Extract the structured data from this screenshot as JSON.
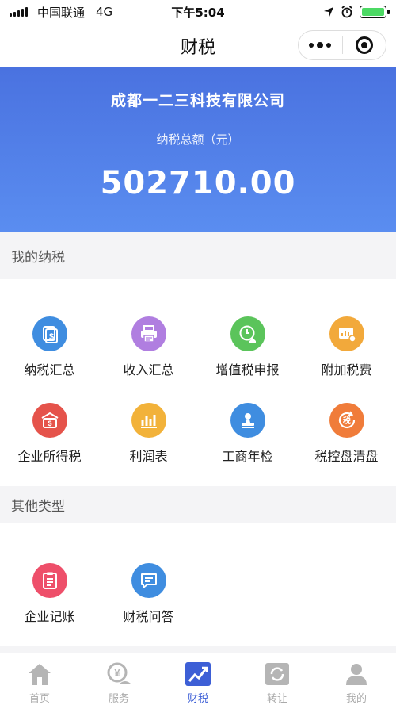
{
  "status_bar": {
    "carrier": "中国联通",
    "network": "4G",
    "time": "下午5:04"
  },
  "nav": {
    "title": "财税"
  },
  "hero": {
    "company": "成都一二三科技有限公司",
    "amount_label": "纳税总额（元）",
    "amount": "502710.00"
  },
  "sections": {
    "mine": {
      "title": "我的纳税",
      "items": [
        {
          "label": "纳税汇总",
          "icon": "dollar-doc-icon",
          "color": "#3f8de0"
        },
        {
          "label": "收入汇总",
          "icon": "printer-icon",
          "color": "#b07ee0"
        },
        {
          "label": "增值税申报",
          "icon": "clock-home-icon",
          "color": "#5bc45b"
        },
        {
          "label": "附加税费",
          "icon": "chart-card-icon",
          "color": "#f2a93b"
        },
        {
          "label": "企业所得税",
          "icon": "money-box-icon",
          "color": "#e5534b"
        },
        {
          "label": "利润表",
          "icon": "bar-chart-icon",
          "color": "#f2b23a"
        },
        {
          "label": "工商年检",
          "icon": "stamp-icon",
          "color": "#3f8de0"
        },
        {
          "label": "税控盘清盘",
          "icon": "tax-refresh-icon",
          "color": "#f07c3a"
        }
      ]
    },
    "other": {
      "title": "其他类型",
      "items": [
        {
          "label": "企业记账",
          "icon": "ledger-icon",
          "color": "#ee4f6a"
        },
        {
          "label": "财税问答",
          "icon": "chat-icon",
          "color": "#3f8de0"
        }
      ]
    }
  },
  "tabbar": {
    "items": [
      {
        "label": "首页",
        "icon": "home-icon"
      },
      {
        "label": "服务",
        "icon": "service-icon"
      },
      {
        "label": "财税",
        "icon": "trend-icon",
        "active": true
      },
      {
        "label": "转让",
        "icon": "transfer-icon"
      },
      {
        "label": "我的",
        "icon": "user-icon"
      }
    ]
  }
}
